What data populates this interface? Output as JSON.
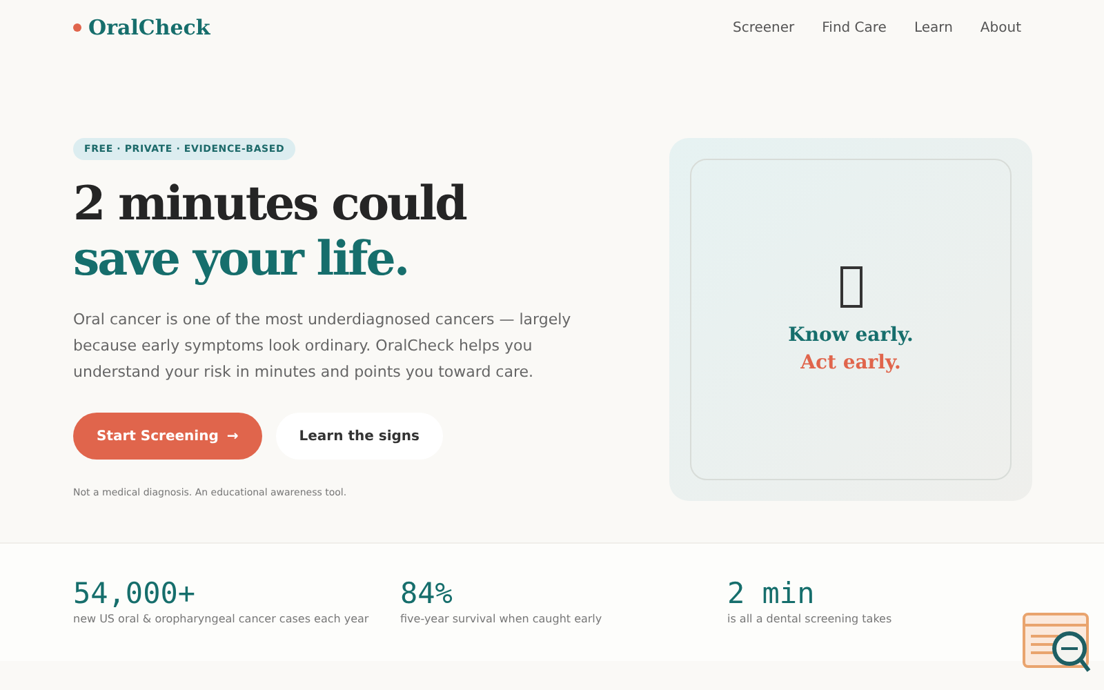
{
  "brand": {
    "name": "OralCheck"
  },
  "nav": [
    {
      "label": "Screener"
    },
    {
      "label": "Find Care"
    },
    {
      "label": "Learn"
    },
    {
      "label": "About"
    }
  ],
  "hero": {
    "badge": "FREE · PRIVATE · EVIDENCE-BASED",
    "title": "2 minutes could",
    "title_accent": "save your life.",
    "intro": "Oral cancer is one of the most underdiagnosed cancers — largely because early symptoms look ordinary. OralCheck helps you understand your risk in minutes and points you toward care.",
    "buttons": [
      {
        "label": "Start Screening",
        "kind": "primary",
        "arrow": "→"
      },
      {
        "label": "Learn the signs",
        "kind": "secondary"
      }
    ],
    "disclaimer": "Not a medical diagnosis. An educational awareness tool."
  },
  "card": {
    "line_1": "Know early.",
    "line_2": "Act early."
  },
  "stats": [
    {
      "value": "54,000+",
      "caption": "new US oral & oropharyngeal cancer cases each year"
    },
    {
      "value": "84%",
      "caption": "five-year survival when caught early"
    },
    {
      "value": "2 min",
      "caption": "is all a dental screening takes"
    }
  ]
}
